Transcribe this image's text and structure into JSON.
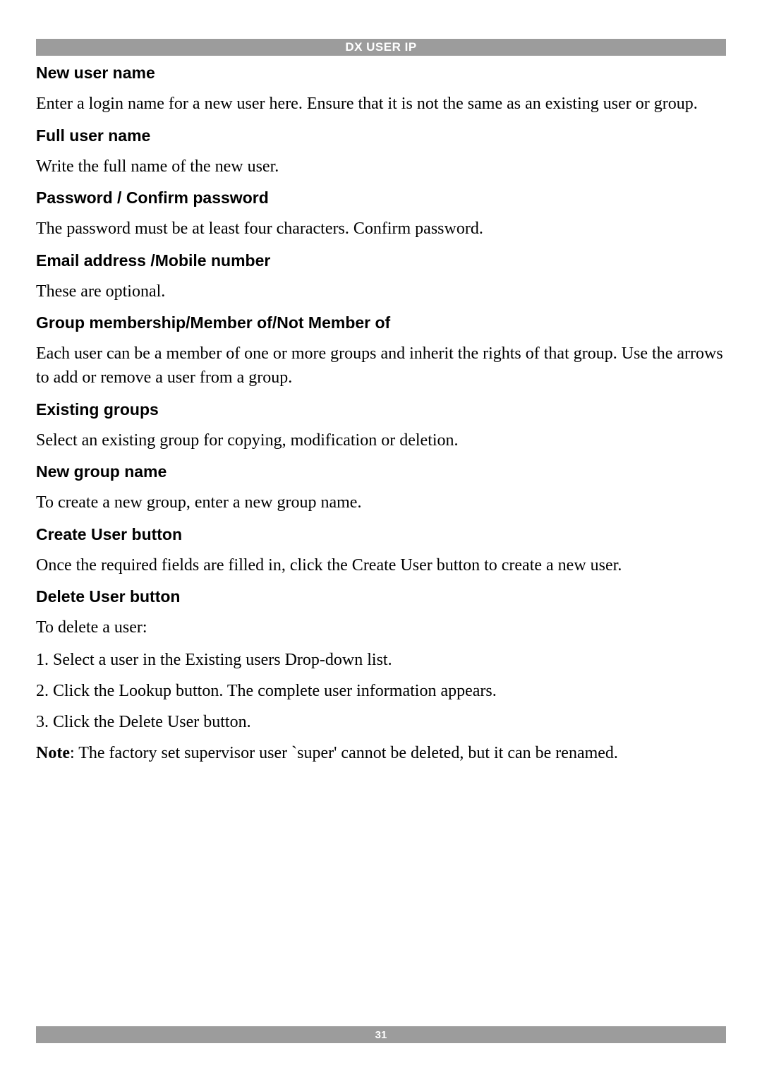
{
  "header": {
    "title": "DX USER IP"
  },
  "sections": {
    "new_user_name": {
      "heading": "New user name",
      "body": "Enter a login name for a new user here. Ensure that it is not the same as an existing user or group."
    },
    "full_user_name": {
      "heading": "Full user name",
      "body": "Write the full name of the new user."
    },
    "password": {
      "heading": "Password / Confirm password",
      "body": "The password must be at least four characters. Confirm password."
    },
    "email": {
      "heading": "Email address /Mobile number",
      "body": "These are optional."
    },
    "group_membership": {
      "heading": "Group membership/Member of/Not Member of",
      "body": "Each user can be a member of one or more groups and inherit the rights of that group. Use the arrows to add or remove a user from a group."
    },
    "existing_groups": {
      "heading": "Existing groups",
      "body": "Select an existing group for copying, modification or deletion."
    },
    "new_group_name": {
      "heading": "New group name",
      "body": "To create a new group, enter a new group name."
    },
    "create_user": {
      "heading": "Create User button",
      "body": "Once the required fields are filled in, click the Create User button to create a new user."
    },
    "delete_user": {
      "heading": "Delete User button",
      "intro": "To delete a user:",
      "steps": [
        "1.  Select a user in the Existing users Drop-down list.",
        "2.  Click the Lookup button. The complete user information appears.",
        "3.  Click the Delete User button."
      ],
      "note_label": "Note",
      "note_body": ": The factory set supervisor user `super' cannot be deleted, but it can be renamed."
    }
  },
  "footer": {
    "page_number": "31"
  }
}
